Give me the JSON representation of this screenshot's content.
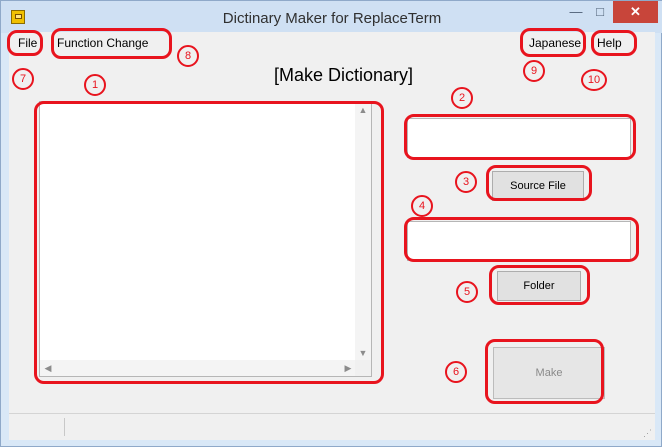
{
  "window": {
    "title": "Dictinary Maker for ReplaceTerm",
    "controls": {
      "minimize": "—",
      "maximize": "□",
      "close": "✕"
    }
  },
  "menu": {
    "file": "File",
    "function_change": "Function Change",
    "japanese": "Japanese",
    "help": "Help"
  },
  "heading": "[Make Dictionary]",
  "list": {
    "scroll_up": "▲",
    "scroll_down": "▼",
    "scroll_left": "◀",
    "scroll_right": "▶"
  },
  "source_file_path": "",
  "folder_path": "",
  "buttons": {
    "source_file": "Source File",
    "folder": "Folder",
    "make": "Make"
  },
  "annotations": [
    "1",
    "2",
    "3",
    "4",
    "5",
    "6",
    "7",
    "8",
    "9",
    "10"
  ],
  "colors": {
    "annotation": "#e8141e",
    "titlebar": "#cfe0f3",
    "close": "#c8453a"
  },
  "icons": {
    "app": "app-icon",
    "grip": "size-grip-icon"
  }
}
